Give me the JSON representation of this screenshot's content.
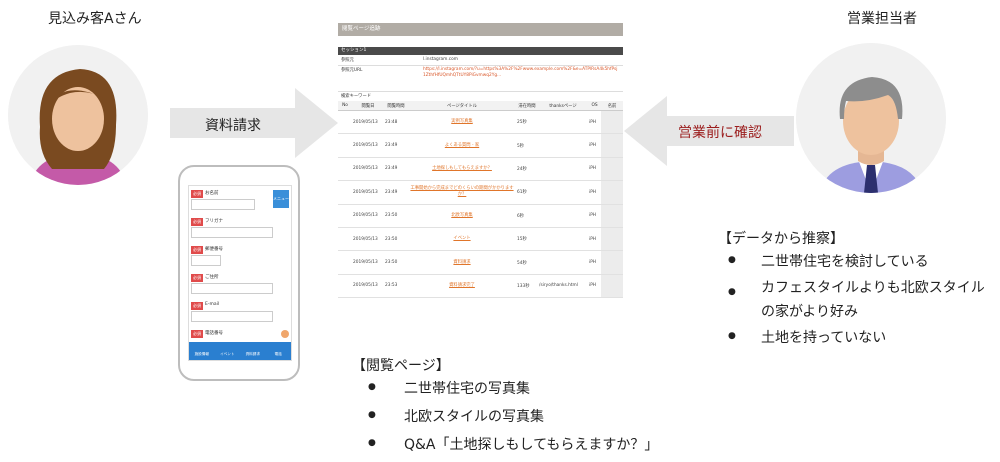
{
  "prospect": {
    "label": "見込み客Aさん"
  },
  "sales": {
    "label": "営業担当者"
  },
  "arrows": {
    "request": "資料請求",
    "confirm": "営業前に確認"
  },
  "phone": {
    "fields": [
      {
        "req": "必須",
        "label": "お名前"
      },
      {
        "req": "必須",
        "label": "フリガナ"
      },
      {
        "req": "必須",
        "label": "郵便番号"
      },
      {
        "req": "必須",
        "label": "ご住所"
      },
      {
        "req": "必須",
        "label": "E-mail"
      },
      {
        "req": "必須",
        "label": "電話番号"
      }
    ],
    "menu": "メニュー",
    "nav": [
      "施設情報",
      "イベント",
      "資料請求",
      "電話"
    ]
  },
  "screenshot": {
    "title": "閲覧ページ追跡",
    "session": "セッション1",
    "rows": [
      {
        "k": "参照元",
        "v": "l.instagram.com",
        "link": false
      },
      {
        "k": "参照元URL",
        "v": "https://l.instagram.com/?u=https%3A%2F%2Fwww.example.com%2F&e=ATPlRsA4k5hfPsj1ZthfHfUQmhQTtUY8PiGvmwq2Yg...",
        "link": true
      },
      {
        "k": "検索キーワード",
        "v": "",
        "link": false
      }
    ],
    "headers": [
      "No",
      "閲覧日",
      "閲覧時間",
      "ページタイトル",
      "滞在時間",
      "thanksページ",
      "OS",
      "名前"
    ],
    "log": [
      {
        "date": "2019/05/13",
        "time": "23:48",
        "title": "実例写真集",
        "stay": "25秒",
        "thanks": "",
        "os": "iPH"
      },
      {
        "date": "2019/05/13",
        "time": "23:49",
        "title": "よくある質問 - 家",
        "stay": "5秒",
        "thanks": "",
        "os": "iPH"
      },
      {
        "date": "2019/05/13",
        "time": "23:49",
        "title": "土地探しもしてもらえますか？",
        "stay": "24秒",
        "thanks": "",
        "os": "iPH"
      },
      {
        "date": "2019/05/13",
        "time": "23:49",
        "title": "工事開始から完成までどのくらいの期間がかかりますか？",
        "stay": "61秒",
        "thanks": "",
        "os": "iPH"
      },
      {
        "date": "2019/05/13",
        "time": "23:50",
        "title": "北欧写真集",
        "stay": "6秒",
        "thanks": "",
        "os": "iPH"
      },
      {
        "date": "2019/05/13",
        "time": "23:50",
        "title": "イベント",
        "stay": "15秒",
        "thanks": "",
        "os": "iPH"
      },
      {
        "date": "2019/05/13",
        "time": "23:50",
        "title": "資料請求",
        "stay": "54秒",
        "thanks": "",
        "os": "iPH"
      },
      {
        "date": "2019/05/13",
        "time": "23:53",
        "title": "資料請求完了",
        "stay": "133秒",
        "thanks": "/siryo/thanks.html",
        "os": "iPH"
      }
    ]
  },
  "inference": {
    "title": "【データから推察】",
    "items": [
      "二世帯住宅を検討している",
      "カフェスタイルよりも北欧スタイルの家がより好み",
      "土地を持っていない"
    ]
  },
  "viewed": {
    "title": "【閲覧ページ】",
    "items": [
      "二世帯住宅の写真集",
      "北欧スタイルの写真集",
      "Q&A「土地探しもしてもらえますか？」"
    ]
  },
  "bullet": "●"
}
